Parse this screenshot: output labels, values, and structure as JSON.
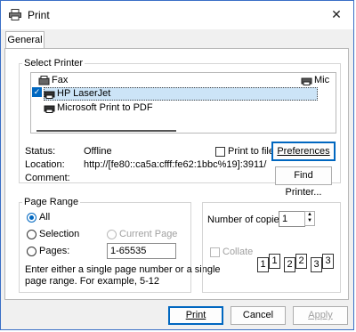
{
  "window": {
    "title": "Print",
    "close_glyph": "✕"
  },
  "tabs": [
    {
      "label": "General"
    }
  ],
  "select_printer": {
    "group_label": "Select Printer",
    "printers": [
      {
        "name": "Fax",
        "icon": "fax-icon"
      },
      {
        "name": "HP LaserJet",
        "icon": "printer-icon",
        "selected": true
      },
      {
        "name": "Microsoft Print to PDF",
        "icon": "printer-icon"
      },
      {
        "name": "Mic",
        "icon": "printer-icon"
      }
    ],
    "status_label": "Status:",
    "status_value": "Offline",
    "location_label": "Location:",
    "location_value": "http://[fe80::ca5a:cfff:fe62:1bbc%19]:3911/",
    "comment_label": "Comment:",
    "print_to_file_label": "Print to file",
    "preferences_label": "Preferences",
    "find_printer_label": "Find Printer..."
  },
  "page_range": {
    "group_label": "Page Range",
    "all_label": "All",
    "selection_label": "Selection",
    "current_page_label": "Current Page",
    "pages_label": "Pages:",
    "pages_value": "1-65535",
    "help_text_1": "Enter either a single page number or a single",
    "help_text_2": "page range.  For example, 5-12"
  },
  "copies": {
    "label": "Number of copies:",
    "value": "1",
    "collate_label": "Collate",
    "collate_pages": [
      "1",
      "1",
      "2",
      "2",
      "3",
      "3"
    ]
  },
  "buttons": {
    "print": "Print",
    "cancel": "Cancel",
    "apply": "Apply"
  }
}
